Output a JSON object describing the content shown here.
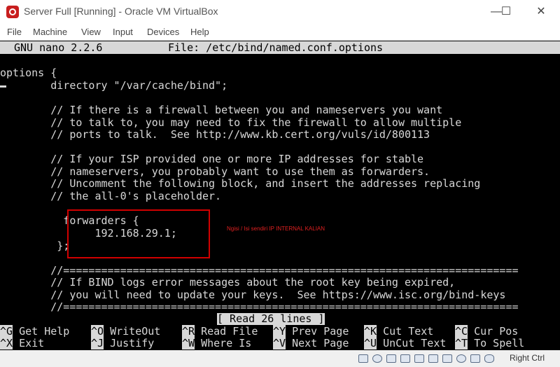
{
  "window": {
    "title": "Server Full [Running] - Oracle VM VirtualBox",
    "minimize": "—",
    "maximize": "☐",
    "close": "✕"
  },
  "menu": [
    "File",
    "Machine",
    "View",
    "Input",
    "Devices",
    "Help"
  ],
  "nano": {
    "version": "GNU nano 2.2.6",
    "file": "File: /etc/bind/named.conf.options"
  },
  "lines": [
    "options {",
    "        directory \"/var/cache/bind\";",
    "",
    "        // If there is a firewall between you and nameservers you want",
    "        // to talk to, you may need to fix the firewall to allow multiple",
    "        // ports to talk.  See http://www.kb.cert.org/vuls/id/800113",
    "",
    "        // If your ISP provided one or more IP addresses for stable",
    "        // nameservers, you probably want to use them as forwarders.",
    "        // Uncomment the following block, and insert the addresses replacing",
    "        // the all-0's placeholder.",
    "",
    "          forwarders {",
    "               192.168.29.1;",
    "         };",
    "",
    "        //========================================================================",
    "        // If BIND logs error messages about the root key being expired,",
    "        // you will need to update your keys.  See https://www.isc.org/bind-keys",
    "        //========================================================================"
  ],
  "annotation": "Ngisi / Isi sendiri IP INTERNAL KALIAN",
  "status_message": "[ Read 26 lines ]",
  "shortcuts": [
    {
      "key": "^G",
      "label": "Get Help"
    },
    {
      "key": "^O",
      "label": "WriteOut"
    },
    {
      "key": "^R",
      "label": "Read File"
    },
    {
      "key": "^Y",
      "label": "Prev Page"
    },
    {
      "key": "^K",
      "label": "Cut Text"
    },
    {
      "key": "^C",
      "label": "Cur Pos"
    },
    {
      "key": "^X",
      "label": "Exit"
    },
    {
      "key": "^J",
      "label": "Justify"
    },
    {
      "key": "^W",
      "label": "Where Is"
    },
    {
      "key": "^V",
      "label": "Next Page"
    },
    {
      "key": "^U",
      "label": "UnCut Text"
    },
    {
      "key": "^T",
      "label": "To Spell"
    }
  ],
  "statusbar": {
    "host_key": "Right Ctrl",
    "icons": [
      "hdd-icon",
      "optical-icon",
      "audio-icon",
      "network-icon",
      "usb-icon",
      "shared-folder-icon",
      "display-icon",
      "recording-icon",
      "cpu-icon",
      "mouse-icon"
    ]
  }
}
